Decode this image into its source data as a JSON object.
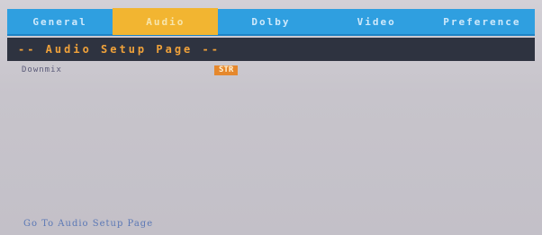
{
  "tabs": [
    {
      "label": "General"
    },
    {
      "label": "Audio"
    },
    {
      "label": "Dolby"
    },
    {
      "label": "Video"
    },
    {
      "label": "Preference"
    }
  ],
  "active_tab": "Audio",
  "header": {
    "title": "-- Audio Setup Page --"
  },
  "settings": [
    {
      "label": "Downmix",
      "value": "STR"
    }
  ],
  "footer": {
    "text": "Go To Audio Setup Page"
  },
  "colors": {
    "tab_bar": "#2f9fe0",
    "active_tab": "#f2b531",
    "header_bg": "#2e3340",
    "header_text": "#f0a23a",
    "value_highlight": "#e5882d"
  }
}
